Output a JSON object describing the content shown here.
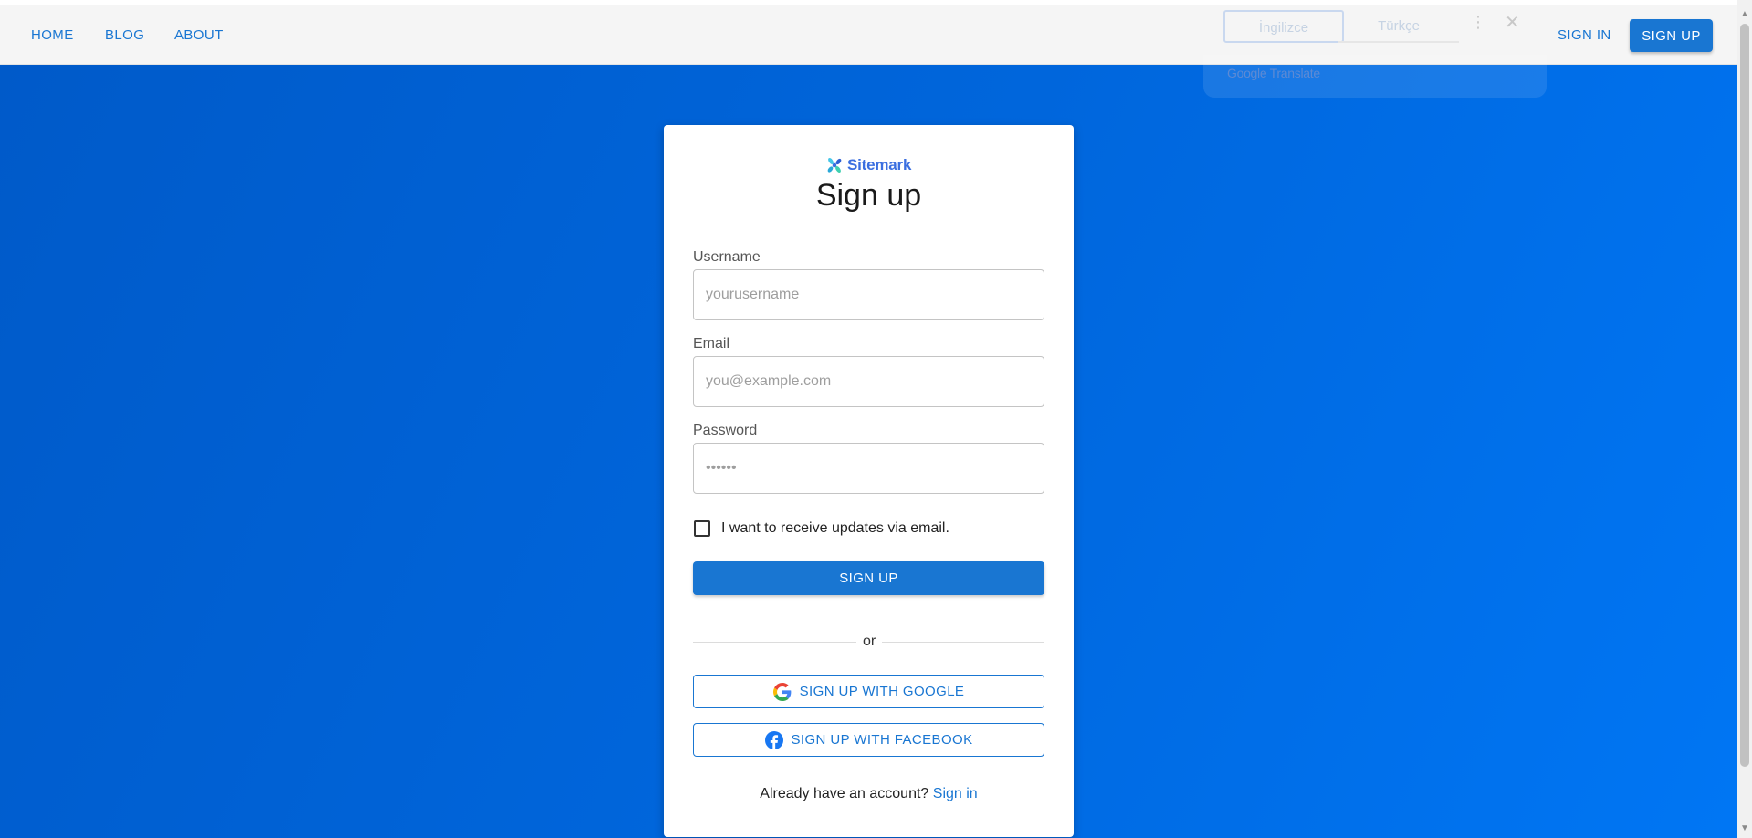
{
  "nav": {
    "home": "HOME",
    "blog": "BLOG",
    "about": "ABOUT",
    "sign_in": "SIGN IN",
    "sign_up": "SIGN UP"
  },
  "translate": {
    "source_lang": "İngilizce",
    "target_lang": "Türkçe",
    "brand": "Google Translate",
    "more_icon": "more-vert-icon",
    "close_icon": "close-icon"
  },
  "card": {
    "logo_text": "Sitemark",
    "title": "Sign up",
    "username": {
      "label": "Username",
      "placeholder": "yourusername",
      "value": ""
    },
    "email": {
      "label": "Email",
      "placeholder": "you@example.com",
      "value": ""
    },
    "password": {
      "label": "Password",
      "placeholder": "••••••",
      "value": ""
    },
    "updates_checkbox": {
      "label": "I want to receive updates via email.",
      "checked": false
    },
    "submit_label": "SIGN UP",
    "divider_text": "or",
    "google_label": "SIGN UP WITH GOOGLE",
    "facebook_label": "SIGN UP WITH FACEBOOK",
    "footer_prompt": "Already have an account? ",
    "footer_link": "Sign in"
  },
  "colors": {
    "primary": "#1976d2",
    "background": "#0066dc",
    "logo": "#3b6fe0"
  }
}
